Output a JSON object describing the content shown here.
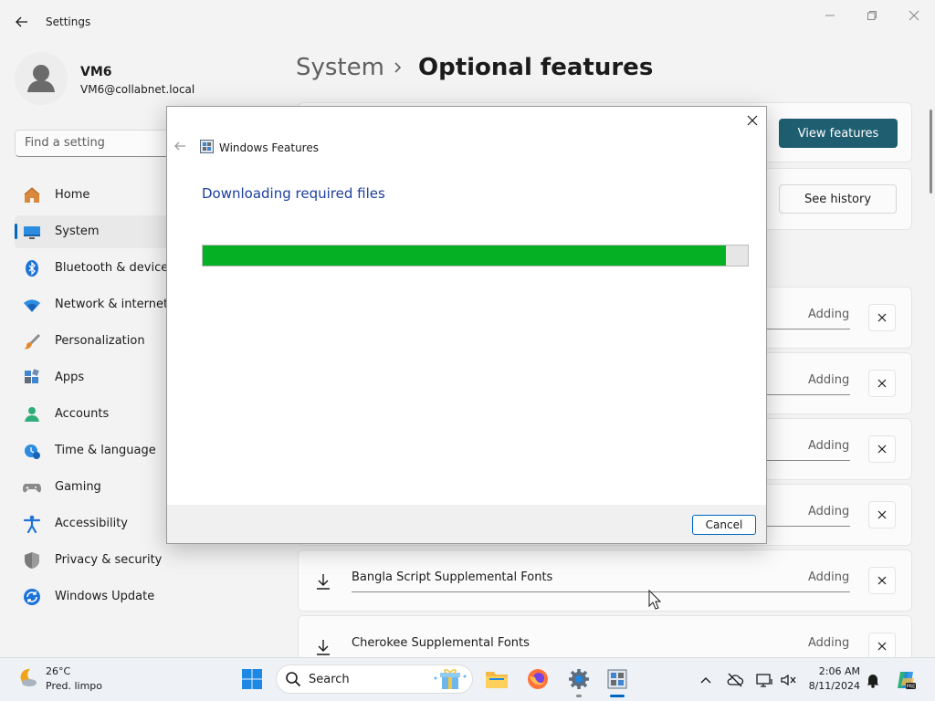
{
  "window": {
    "title": "Settings"
  },
  "user": {
    "name": "VM6",
    "email": "VM6@collabnet.local"
  },
  "search": {
    "placeholder": "Find a setting"
  },
  "nav": {
    "items": [
      {
        "label": "Home",
        "icon": "home-icon"
      },
      {
        "label": "System",
        "icon": "system-icon",
        "selected": true
      },
      {
        "label": "Bluetooth & devices",
        "icon": "bluetooth-icon"
      },
      {
        "label": "Network & internet",
        "icon": "wifi-icon"
      },
      {
        "label": "Personalization",
        "icon": "brush-icon"
      },
      {
        "label": "Apps",
        "icon": "apps-icon"
      },
      {
        "label": "Accounts",
        "icon": "accounts-icon"
      },
      {
        "label": "Time & language",
        "icon": "time-language-icon"
      },
      {
        "label": "Gaming",
        "icon": "gamepad-icon"
      },
      {
        "label": "Accessibility",
        "icon": "accessibility-icon"
      },
      {
        "label": "Privacy & security",
        "icon": "shield-icon"
      },
      {
        "label": "Windows Update",
        "icon": "windows-update-icon"
      }
    ]
  },
  "header": {
    "parent": "System",
    "current": "Optional features"
  },
  "actions": {
    "view_features": "View features",
    "see_history": "See history"
  },
  "installing": {
    "status_label": "Adding",
    "rows": [
      {
        "name": ""
      },
      {
        "name": ""
      },
      {
        "name": ""
      },
      {
        "name": ""
      },
      {
        "name": "Bangla Script Supplemental Fonts"
      },
      {
        "name": "Cherokee Supplemental Fonts"
      }
    ]
  },
  "dialog": {
    "title": "Windows Features",
    "heading": "Downloading required files",
    "progress": 0.96,
    "cancel": "Cancel"
  },
  "taskbar": {
    "weather": {
      "temp": "26°C",
      "desc": "Pred. limpo"
    },
    "search_label": "Search",
    "clock": {
      "time": "2:06 AM",
      "date": "8/11/2024"
    }
  },
  "colors": {
    "accent": "#0067c0",
    "primary_button": "#1f5e71",
    "progress_fill": "#06b025",
    "dialog_heading": "#1c3f9e"
  }
}
